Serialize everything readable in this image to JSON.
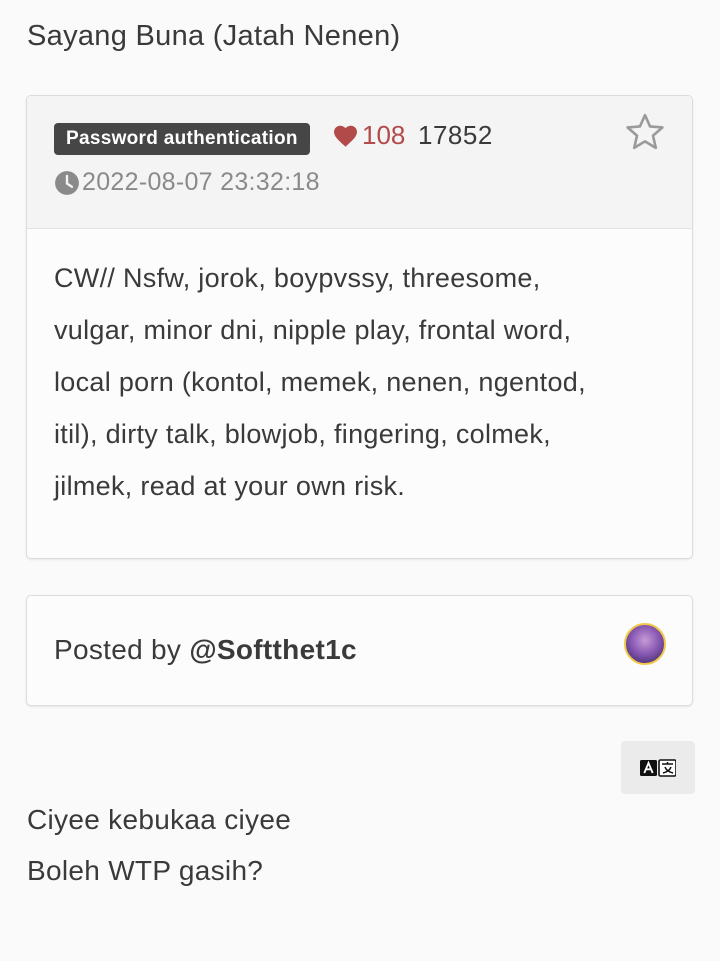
{
  "page": {
    "title": "Sayang Buna (Jatah Nenen)"
  },
  "post": {
    "badge": "Password authentication",
    "likes": "108",
    "views": "17852",
    "date": "2022-08-07 23:32:18",
    "body_lines": [
      "CW// Nsfw, jorok, boypvssy, threesome,",
      "vulgar, minor dni, nipple play, frontal word,",
      "local porn (kontol, memek, nenen, ngentod,",
      "itil), dirty talk, blowjob, fingering, colmek,",
      "jilmek, read at your own risk."
    ]
  },
  "author": {
    "prefix": "Posted by ",
    "handle": "@Softthet1c"
  },
  "comment": {
    "lines": [
      "Ciyee kebukaa ciyee",
      "Boleh WTP gasih?"
    ]
  },
  "icons": {
    "like": "heart-icon",
    "date": "clock-icon",
    "favorite": "star-outline-icon",
    "translate": "translate-icon",
    "avatar": "avatar"
  },
  "colors": {
    "like": "#b34a4a",
    "badge_bg": "#464646",
    "avatar_ring": "#f1c94a"
  }
}
